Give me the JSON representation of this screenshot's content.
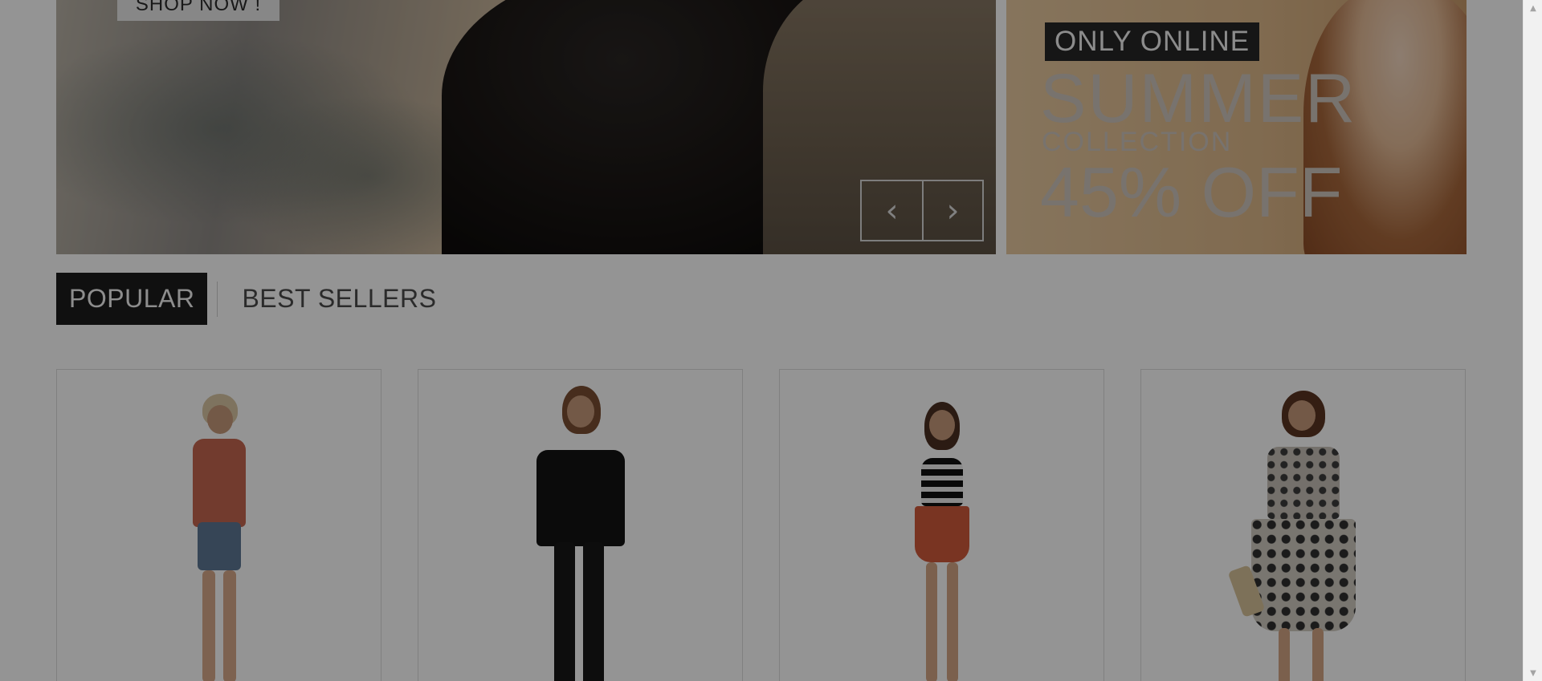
{
  "slider": {
    "cta_label": "SHOP NOW !",
    "prev_icon": "chevron-left-icon",
    "next_icon": "chevron-right-icon",
    "prev_glyph": "‹",
    "next_glyph": "›"
  },
  "promo": {
    "tag": "ONLY ONLINE",
    "headline": "SUMMER",
    "subheadline": "COLLECTION",
    "discount": "45% OFF"
  },
  "tabs": [
    {
      "label": "POPULAR",
      "active": true
    },
    {
      "label": "BEST SELLERS",
      "active": false
    }
  ],
  "products": [
    {
      "alt": "product-1"
    },
    {
      "alt": "product-2"
    },
    {
      "alt": "product-3"
    },
    {
      "alt": "product-4"
    }
  ],
  "scrollbar": {
    "up_glyph": "▲",
    "down_glyph": "▼"
  },
  "colors": {
    "overlay": "#00000060",
    "accent": "#1c1c1c"
  }
}
